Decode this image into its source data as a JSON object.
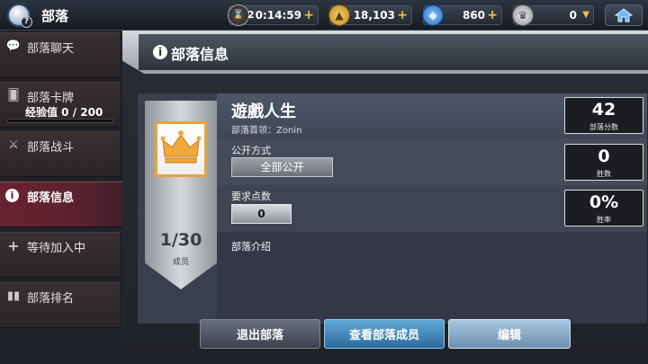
{
  "topbar": {
    "title": "部落",
    "help_badge": "?",
    "timer": {
      "icon": "hourglass-icon",
      "count": "2",
      "value": "0:14:59"
    },
    "gold": {
      "icon": "gold-coin-icon",
      "value": "18,103"
    },
    "gems": {
      "icon": "blue-gem-icon",
      "value": "860"
    },
    "trophy": {
      "icon": "trophy-icon",
      "value": "0"
    },
    "home_icon": "home-icon"
  },
  "sidebar": {
    "items": [
      {
        "label": "部落聊天",
        "icon": "chat-bubbles-icon"
      },
      {
        "label": "部落卡牌",
        "icon": "cards-icon",
        "exp_text": "经验值 0 / 200",
        "exp_progress": 0
      },
      {
        "label": "部落战斗",
        "icon": "crossed-swords-icon"
      },
      {
        "label": "部落信息",
        "icon": "info-icon",
        "active": true
      },
      {
        "label": "等待加入中",
        "icon": "plus-icon"
      },
      {
        "label": "部落排名",
        "icon": "ranking-icon"
      }
    ]
  },
  "main": {
    "header_title": "部落信息",
    "clan": {
      "name": "遊戲人生",
      "leader": "部落首领：Zonin",
      "members": "1/30",
      "members_label": "成员",
      "public_label": "公开方式",
      "public_value": "全部公开",
      "requirement_label": "要求点数",
      "requirement_value": "0",
      "intro_label": "部落介绍"
    },
    "stats": [
      {
        "value": "42",
        "label": "部落分数"
      },
      {
        "value": "0",
        "label": "胜数"
      },
      {
        "value": "0%",
        "label": "胜率"
      }
    ],
    "buttons": {
      "leave": "退出部落",
      "view_members": "查看部落成员",
      "edit": "编辑"
    }
  },
  "colors": {
    "accent_gold": "#f4c242",
    "active_tab": "#6a2330",
    "primary_button": "#3f86bd"
  }
}
